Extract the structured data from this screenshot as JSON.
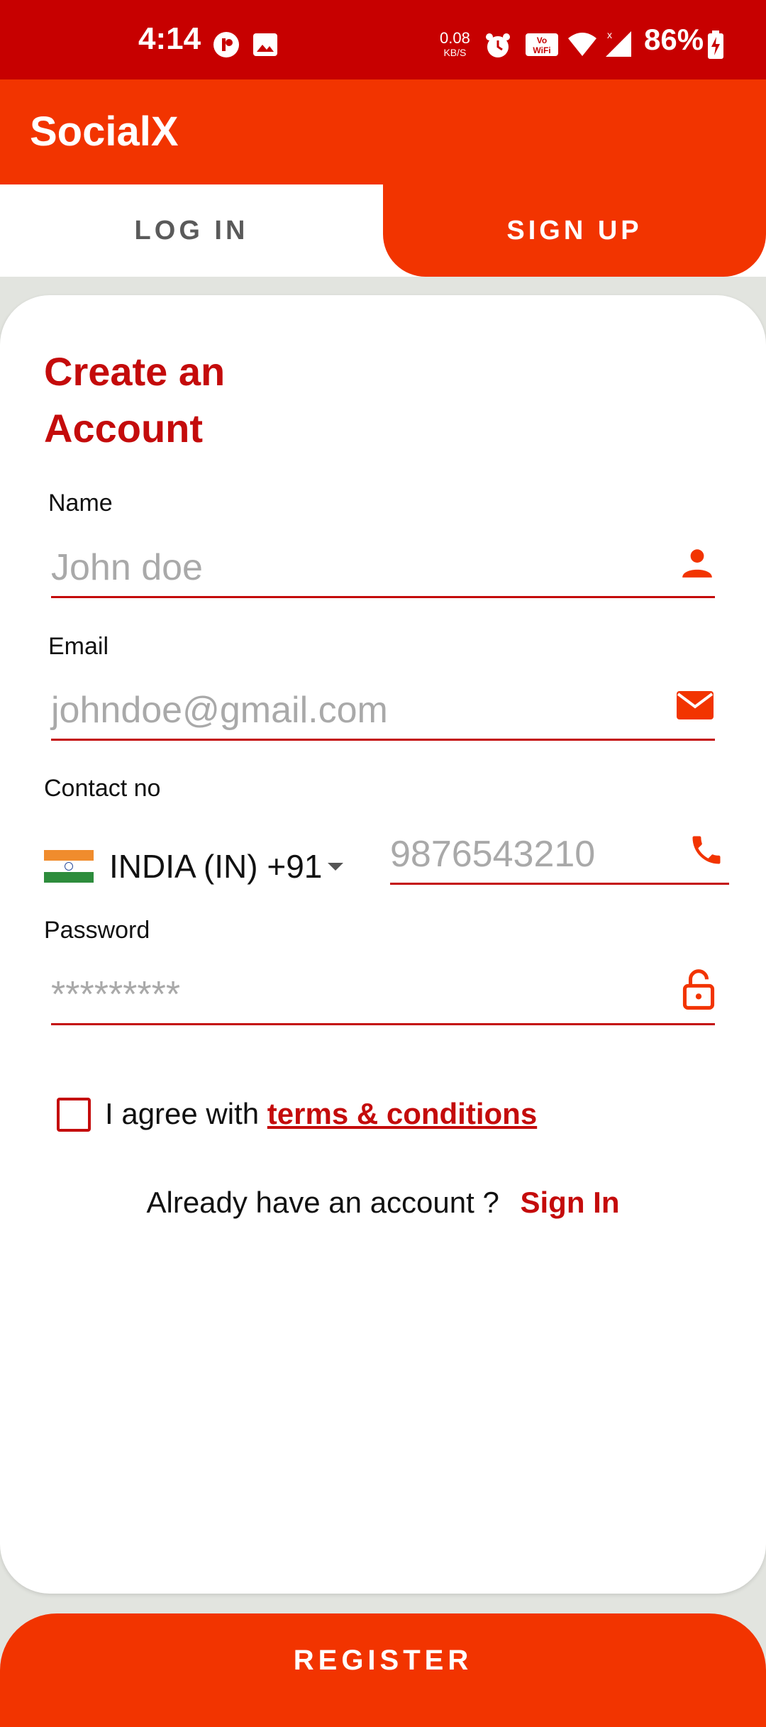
{
  "status_bar": {
    "time": "4:14",
    "net_speed": "0.08",
    "net_speed_unit": "KB/S",
    "battery": "86%"
  },
  "app": {
    "title": "SocialX",
    "accent_color": "#f23400",
    "status_bar_color": "#c70000",
    "text_accent": "#c40b0b"
  },
  "tabs": [
    {
      "label": "LOG IN",
      "selected": false
    },
    {
      "label": "SIGN UP",
      "selected": true
    }
  ],
  "form": {
    "heading_line1": "Create an",
    "heading_line2": "Account",
    "name": {
      "label": "Name",
      "placeholder": "John doe",
      "icon": "person-icon"
    },
    "email": {
      "label": "Email",
      "placeholder": "johndoe@gmail.com",
      "icon": "mail-icon"
    },
    "contact": {
      "label": "Contact no",
      "country": "INDIA (IN) +91",
      "placeholder": "9876543210",
      "icon": "phone-icon"
    },
    "password": {
      "label": "Password",
      "placeholder": "*********",
      "icon": "lock-icon"
    },
    "agree_prefix": "I agree with",
    "terms_link": "terms & conditions",
    "already_text": "Already have an account ?",
    "signin_link": "Sign In"
  },
  "register_button": "REGISTER"
}
